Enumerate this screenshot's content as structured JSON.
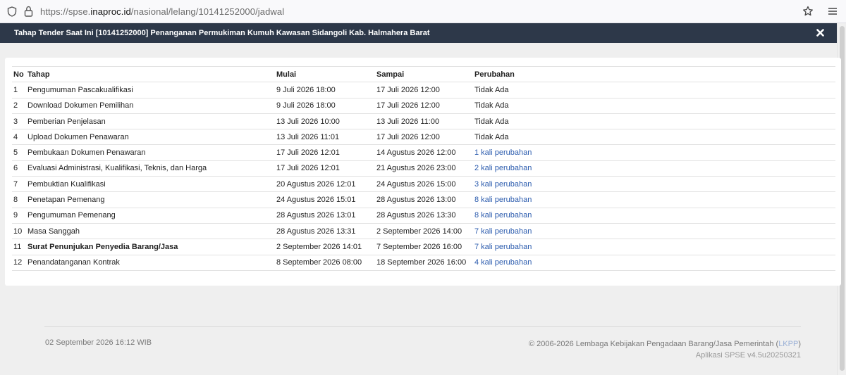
{
  "browser": {
    "url_prefix": "https://spse.",
    "url_domain": "inaproc.id",
    "url_path": "/nasional/lelang/10141252000/jadwal"
  },
  "modal": {
    "title": "Tahap Tender Saat Ini [10141252000] Penanganan Permukiman Kumuh Kawasan Sidangoli Kab. Halmahera Barat"
  },
  "table": {
    "headers": {
      "no": "No",
      "tahap": "Tahap",
      "mulai": "Mulai",
      "sampai": "Sampai",
      "perubahan": "Perubahan"
    },
    "rows": [
      {
        "no": "1",
        "tahap": "Pengumuman Pascakualifikasi",
        "mulai": "9 Juli 2026 18:00",
        "sampai": "17 Juli 2026 12:00",
        "perubahan": "Tidak Ada"
      },
      {
        "no": "2",
        "tahap": "Download Dokumen Pemilihan",
        "mulai": "9 Juli 2026 18:00",
        "sampai": "17 Juli 2026 12:00",
        "perubahan": "Tidak Ada"
      },
      {
        "no": "3",
        "tahap": "Pemberian Penjelasan",
        "mulai": "13 Juli 2026 10:00",
        "sampai": "13 Juli 2026 11:00",
        "perubahan": "Tidak Ada"
      },
      {
        "no": "4",
        "tahap": "Upload Dokumen Penawaran",
        "mulai": "13 Juli 2026 11:01",
        "sampai": "17 Juli 2026 12:00",
        "perubahan": "Tidak Ada"
      },
      {
        "no": "5",
        "tahap": "Pembukaan Dokumen Penawaran",
        "mulai": "17 Juli 2026 12:01",
        "sampai": "14 Agustus 2026 12:00",
        "perubahan": "1 kali perubahan"
      },
      {
        "no": "6",
        "tahap": "Evaluasi Administrasi, Kualifikasi, Teknis, dan Harga",
        "mulai": "17 Juli 2026 12:01",
        "sampai": "21 Agustus 2026 23:00",
        "perubahan": "2 kali perubahan"
      },
      {
        "no": "7",
        "tahap": "Pembuktian Kualifikasi",
        "mulai": "20 Agustus 2026 12:01",
        "sampai": "24 Agustus 2026 15:00",
        "perubahan": "3 kali perubahan"
      },
      {
        "no": "8",
        "tahap": "Penetapan Pemenang",
        "mulai": "24 Agustus 2026 15:01",
        "sampai": "28 Agustus 2026 13:00",
        "perubahan": "8 kali perubahan"
      },
      {
        "no": "9",
        "tahap": "Pengumuman Pemenang",
        "mulai": "28 Agustus 2026 13:01",
        "sampai": "28 Agustus 2026 13:30",
        "perubahan": "8 kali perubahan"
      },
      {
        "no": "10",
        "tahap": "Masa Sanggah",
        "mulai": "28 Agustus 2026 13:31",
        "sampai": "2 September 2026 14:00",
        "perubahan": "7 kali perubahan"
      },
      {
        "no": "11",
        "tahap": "Surat Penunjukan Penyedia Barang/Jasa",
        "mulai": "2 September 2026 14:01",
        "sampai": "7 September 2026 16:00",
        "perubahan": "7 kali perubahan",
        "bold": true
      },
      {
        "no": "12",
        "tahap": "Penandatanganan Kontrak",
        "mulai": "8 September 2026 08:00",
        "sampai": "18 September 2026 16:00",
        "perubahan": "4 kali perubahan"
      }
    ]
  },
  "footer": {
    "datetime": "02 September 2026 16:12 WIB",
    "copyright_prefix": "© 2006-2026 Lembaga Kebijakan Pengadaan Barang/Jasa Pemerintah (",
    "copyright_link": "LKPP",
    "copyright_suffix": ")",
    "version": "Aplikasi SPSE v4.5u20250321"
  },
  "icons": [
    "shield-icon",
    "lock-icon",
    "star-icon",
    "hamburger-menu-icon",
    "close-icon"
  ],
  "colors": {
    "header_bg": "#2d3849",
    "link": "#2c5cae",
    "page_bg": "#efefef"
  }
}
